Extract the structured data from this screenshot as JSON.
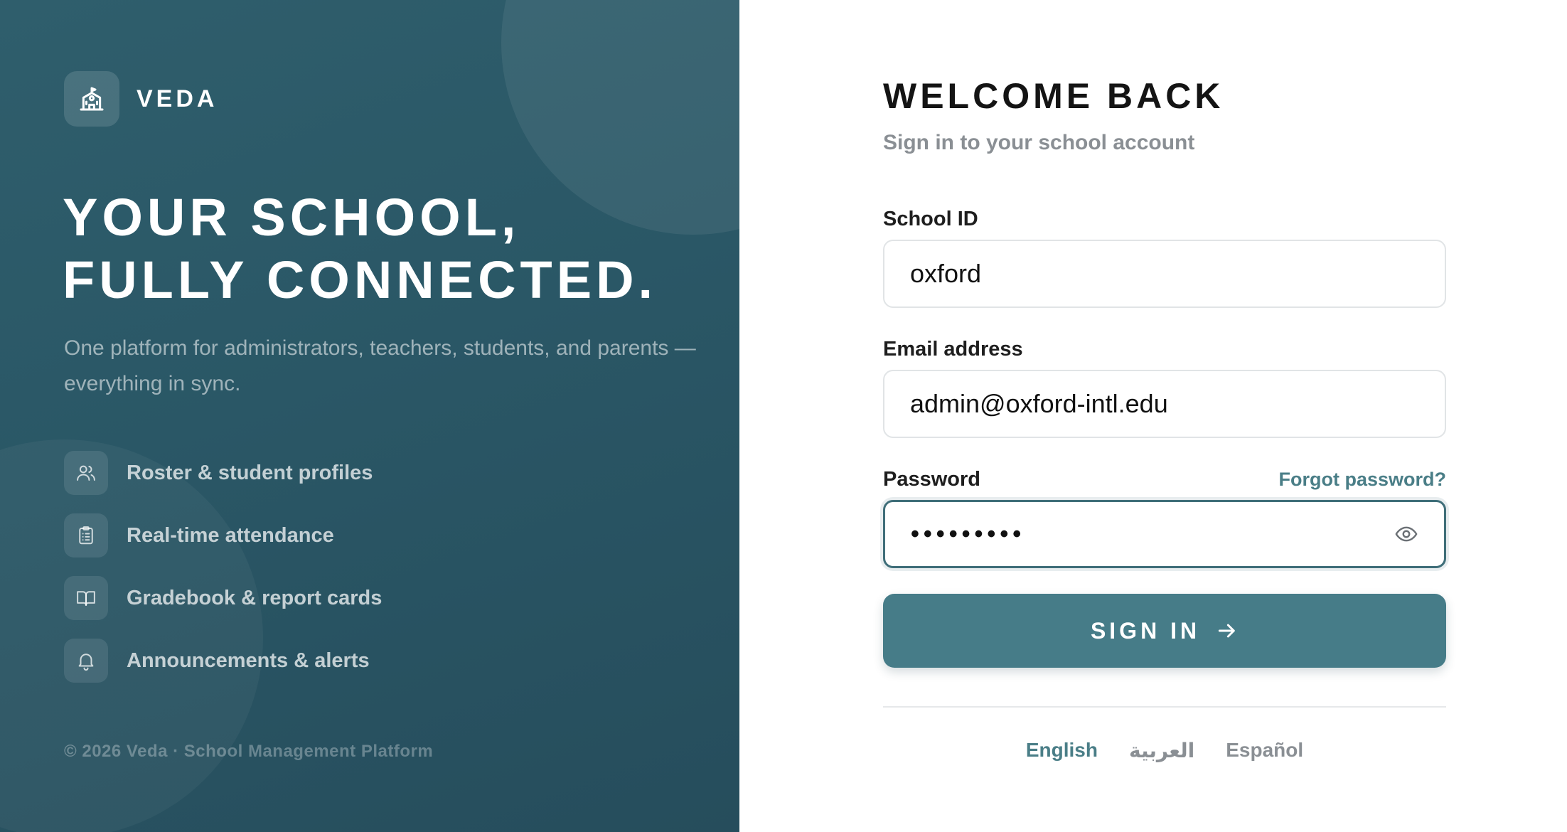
{
  "brand": {
    "name": "VEDA",
    "logo_icon": "school-building-icon"
  },
  "hero": {
    "headline_line1": "YOUR SCHOOL,",
    "headline_line2": "FULLY CONNECTED.",
    "subtitle": "One platform for administrators, teachers, students, and parents — everything in sync."
  },
  "features": [
    {
      "icon": "users-icon",
      "label": "Roster & student profiles"
    },
    {
      "icon": "clipboard-icon",
      "label": "Real-time attendance"
    },
    {
      "icon": "book-open-icon",
      "label": "Gradebook & report cards"
    },
    {
      "icon": "bell-icon",
      "label": "Announcements & alerts"
    }
  ],
  "footer": {
    "copyright": "© 2026 Veda · School Management Platform"
  },
  "form": {
    "title": "WELCOME BACK",
    "subtitle": "Sign in to your school account",
    "school_id": {
      "label": "School ID",
      "value": "oxford"
    },
    "email": {
      "label": "Email address",
      "value": "admin@oxford-intl.edu"
    },
    "password": {
      "label": "Password",
      "masked_value": "•••••••••",
      "forgot_link": "Forgot password?",
      "toggle_icon": "eye-icon"
    },
    "submit_label": "SIGN IN",
    "submit_icon": "arrow-right-icon"
  },
  "languages": {
    "active": "English",
    "options": [
      "English",
      "العربية",
      "Español"
    ]
  },
  "colors": {
    "panel": "#2a5766",
    "accent": "#467c88",
    "link": "#4a7e87"
  }
}
